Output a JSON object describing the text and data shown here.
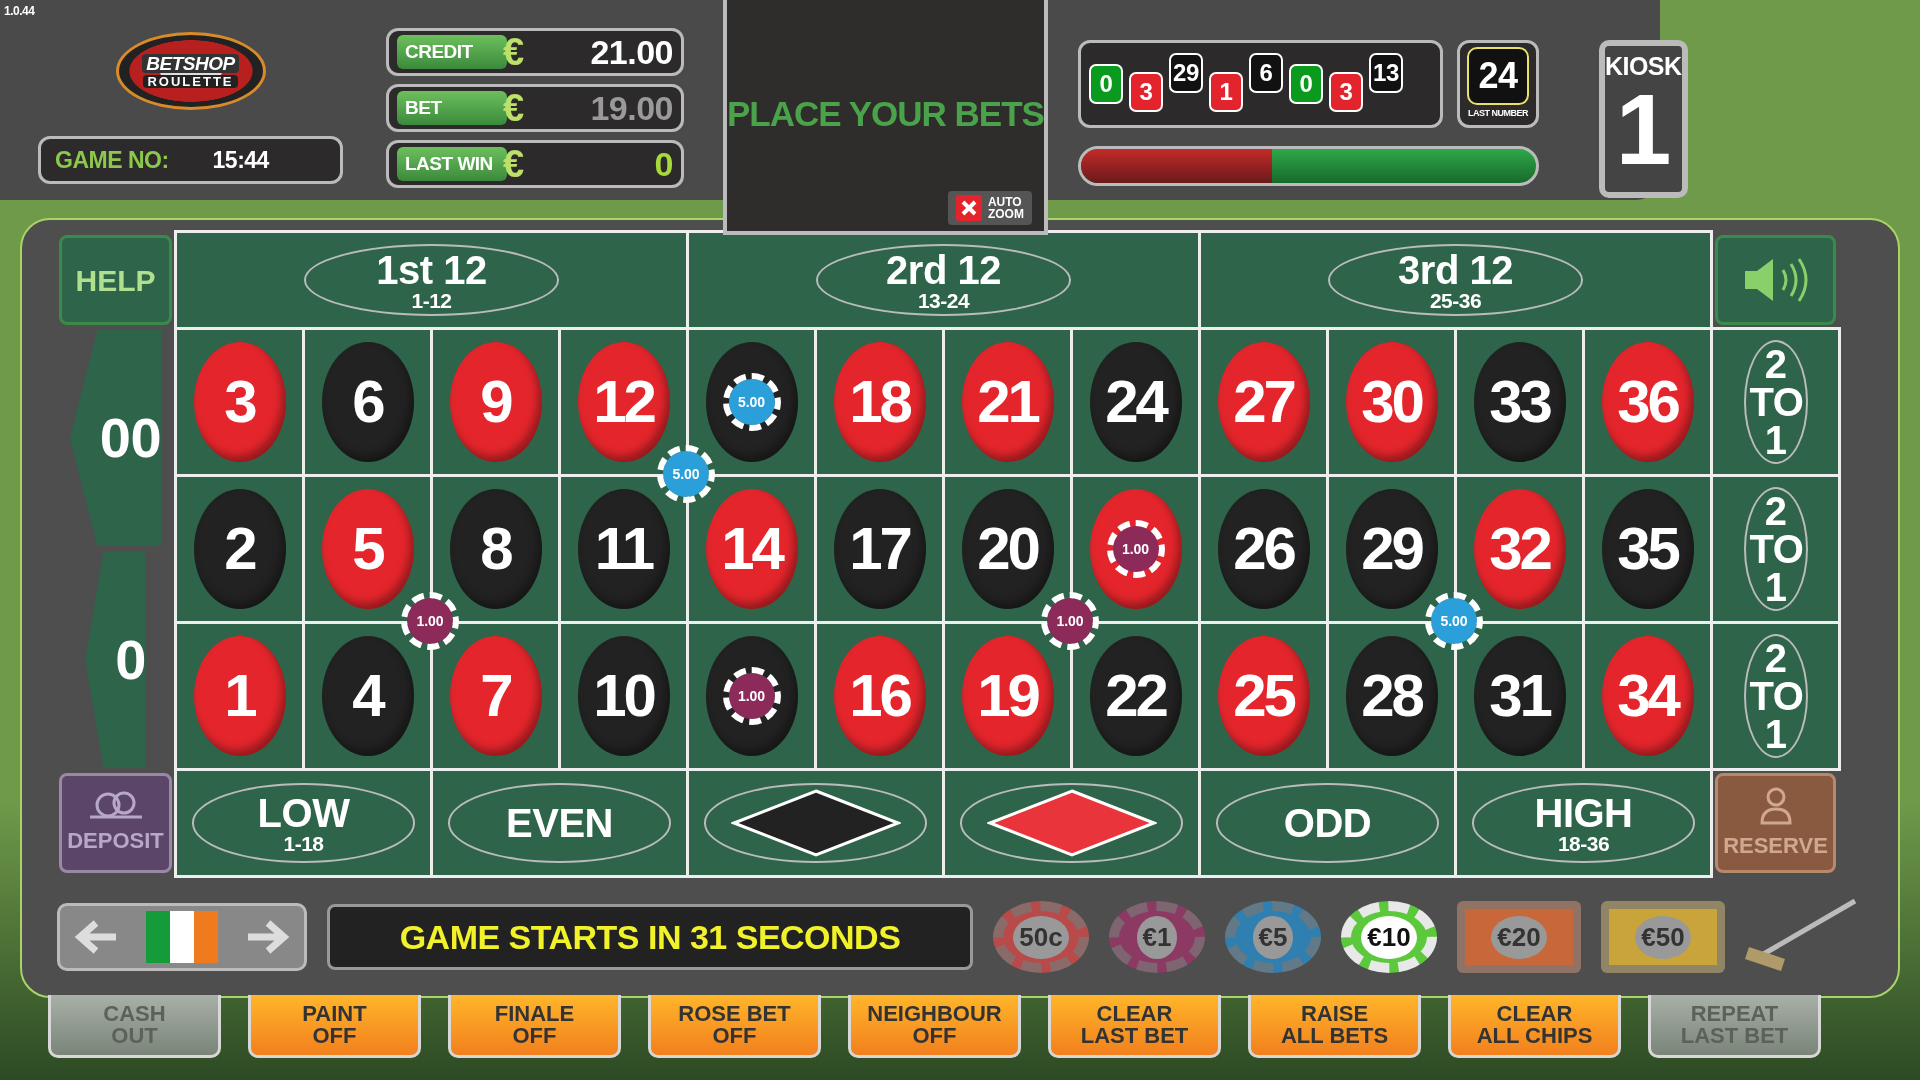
{
  "version": "1.0.44",
  "logo": {
    "line1": "BETSHOP",
    "line2": "ROULETTE"
  },
  "game_number": {
    "label": "GAME NO:",
    "value": "15:44"
  },
  "meters": [
    {
      "label": "CREDIT",
      "currency": "€",
      "value": "21.00",
      "kind": "credit"
    },
    {
      "label": "BET",
      "currency": "€",
      "value": "19.00",
      "kind": "bet"
    },
    {
      "label": "LAST WIN",
      "currency": "€",
      "value": "0",
      "kind": "win"
    }
  ],
  "message": {
    "text": "PLACE YOUR BETS",
    "auto_zoom": {
      "label": "AUTO\nZOOM",
      "on": false
    }
  },
  "history": [
    {
      "label": "0",
      "color": "#0a9a1e"
    },
    {
      "label": "3",
      "color": "#e4242c"
    },
    {
      "label": "29",
      "color": "#111111"
    },
    {
      "label": "1",
      "color": "#e4242c"
    },
    {
      "label": "6",
      "color": "#111111"
    },
    {
      "label": "0",
      "color": "#0a9a1e"
    },
    {
      "label": "3",
      "color": "#e4242c"
    },
    {
      "label": "13",
      "color": "#111111"
    }
  ],
  "last_number": {
    "value": "24",
    "caption": "LAST NUMBER"
  },
  "timer": {
    "level": 0.42
  },
  "kiosk": {
    "label": "KIOSK",
    "number": "1"
  },
  "table": {
    "help": "HELP",
    "dozens": [
      {
        "label": "1st 12",
        "range": "1-12"
      },
      {
        "label": "2rd 12",
        "range": "13-24"
      },
      {
        "label": "3rd 12",
        "range": "25-36"
      }
    ],
    "zeros": [
      "00",
      "0"
    ],
    "number_rows": [
      {
        "cells": [
          {
            "label": "3",
            "color": "#e4262c"
          },
          {
            "label": "6",
            "color": "#222222"
          },
          {
            "label": "9",
            "color": "#e4262c"
          },
          {
            "label": "12",
            "color": "#e4262c",
            "corner_chip": {
              "amount": "5.00",
              "color": "#2b9fd9"
            }
          },
          {
            "color": "#222222",
            "chip": {
              "amount": "5.00",
              "color": "#2b9fd9"
            }
          },
          {
            "label": "18",
            "color": "#e4262c"
          },
          {
            "label": "21",
            "color": "#e4262c"
          },
          {
            "label": "24",
            "color": "#222222"
          },
          {
            "label": "27",
            "color": "#e4262c"
          },
          {
            "label": "30",
            "color": "#e4262c"
          },
          {
            "label": "33",
            "color": "#222222"
          },
          {
            "label": "36",
            "color": "#e4262c"
          }
        ]
      },
      {
        "cells": [
          {
            "label": "2",
            "color": "#222222"
          },
          {
            "label": "5",
            "color": "#e4262c",
            "corner_chip": {
              "amount": "1.00",
              "color": "#8c2a5a"
            }
          },
          {
            "label": "8",
            "color": "#222222"
          },
          {
            "label": "11",
            "color": "#222222"
          },
          {
            "label": "14",
            "color": "#e4262c"
          },
          {
            "label": "17",
            "color": "#222222"
          },
          {
            "label": "20",
            "color": "#222222",
            "corner_chip": {
              "amount": "1.00",
              "color": "#8c2a5a"
            }
          },
          {
            "color": "#e4262c",
            "chip": {
              "amount": "1.00",
              "color": "#8c2a5a"
            }
          },
          {
            "label": "26",
            "color": "#222222"
          },
          {
            "label": "29",
            "color": "#222222",
            "corner_chip": {
              "amount": "5.00",
              "color": "#2b9fd9"
            }
          },
          {
            "label": "32",
            "color": "#e4262c"
          },
          {
            "label": "35",
            "color": "#222222"
          }
        ]
      },
      {
        "cells": [
          {
            "label": "1",
            "color": "#e4262c"
          },
          {
            "label": "4",
            "color": "#222222"
          },
          {
            "label": "7",
            "color": "#e4262c"
          },
          {
            "label": "10",
            "color": "#222222"
          },
          {
            "color": "#222222",
            "chip": {
              "amount": "1.00",
              "color": "#8c2a5a"
            }
          },
          {
            "label": "16",
            "color": "#e4262c"
          },
          {
            "label": "19",
            "color": "#e4262c"
          },
          {
            "label": "22",
            "color": "#222222"
          },
          {
            "label": "25",
            "color": "#e4262c"
          },
          {
            "label": "28",
            "color": "#222222"
          },
          {
            "label": "31",
            "color": "#222222"
          },
          {
            "label": "34",
            "color": "#e4262c"
          }
        ]
      }
    ],
    "columns": [
      "2 TO 1",
      "2 TO 1",
      "2 TO 1"
    ],
    "deposit": "DEPOSIT",
    "reserve": "RESERVE",
    "outside": [
      {
        "kind": "text",
        "label": "LOW",
        "range": "1-18"
      },
      {
        "kind": "text",
        "label": "EVEN"
      },
      {
        "kind": "diamond",
        "color": "#222222"
      },
      {
        "kind": "diamond",
        "color": "#e8343a"
      },
      {
        "kind": "text",
        "label": "ODD"
      },
      {
        "kind": "text",
        "label": "HIGH",
        "range": "18-36"
      }
    ]
  },
  "countdown": "GAME STARTS IN 31 SECONDS",
  "chips": [
    {
      "label": "50c",
      "kind": "round",
      "color": "#b84a4a",
      "selected": false
    },
    {
      "label": "€1",
      "kind": "round",
      "color": "#8c3a63",
      "selected": false
    },
    {
      "label": "€5",
      "kind": "round",
      "color": "#2f7fb0",
      "selected": false
    },
    {
      "label": "€10",
      "kind": "round",
      "color": "#5cc83c",
      "selected": true
    },
    {
      "label": "€20",
      "kind": "plaque",
      "color": "#c8683a",
      "selected": false
    },
    {
      "label": "€50",
      "kind": "plaque",
      "color": "#c8a43a",
      "selected": false
    }
  ],
  "buttons": [
    {
      "label": "CASH\nOUT",
      "disabled": true
    },
    {
      "label": "PAINT\nOFF",
      "disabled": false
    },
    {
      "label": "FINALE\nOFF",
      "disabled": false
    },
    {
      "label": "ROSE BET\nOFF",
      "disabled": false
    },
    {
      "label": "NEIGHBOUR\nOFF",
      "disabled": false
    },
    {
      "label": "CLEAR\nLAST BET",
      "disabled": false
    },
    {
      "label": "RAISE\nALL BETS",
      "disabled": false
    },
    {
      "label": "CLEAR\nALL CHIPS",
      "disabled": false
    },
    {
      "label": "REPEAT\nLAST BET",
      "disabled": true
    }
  ]
}
